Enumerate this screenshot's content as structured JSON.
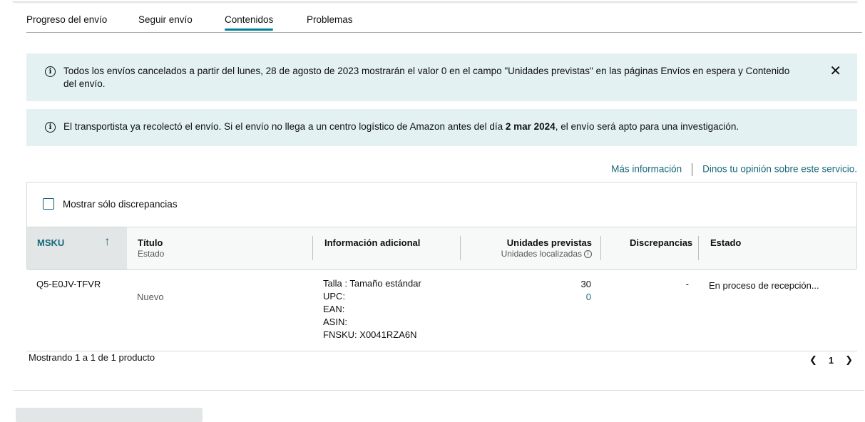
{
  "tabs": [
    {
      "label": "Progreso del envío"
    },
    {
      "label": "Seguir envío"
    },
    {
      "label": "Contenidos"
    },
    {
      "label": "Problemas"
    }
  ],
  "alerts": {
    "cancelled": {
      "line1": "Todos los envíos cancelados a partir del lunes, 28 de agosto de 2023 mostrarán el valor 0 en el campo \"Unidades previstas\" en las páginas Envíos en espera y Contenido",
      "line2": "del envío."
    },
    "carrier": {
      "before": "El transportista ya recolectó el envío. Si el envío no llega a un centro logístico de Amazon antes del día ",
      "date": "2 mar 2024",
      "after": ", el envío será apto para una investigación."
    }
  },
  "links": {
    "more_info": "Más información",
    "feedback": "Dinos tu opinión sobre este servicio."
  },
  "filter": {
    "show_discrepancies_label": "Mostrar sólo discrepancias"
  },
  "table": {
    "headers": {
      "msku": "MSKU",
      "title": "Título",
      "title_sub": "Estado",
      "info": "Información adicional",
      "expected": "Unidades previstas",
      "expected_sub": "Unidades localizadas",
      "discrepancies": "Discrepancias",
      "status": "Estado"
    },
    "rows": [
      {
        "msku": "Q5-E0JV-TFVR",
        "condition": "Nuevo",
        "info": {
          "size": "Talla : Tamaño estándar",
          "upc": "UPC:",
          "ean": "EAN:",
          "asin": "ASIN:",
          "fnsku": "FNSKU: X0041RZA6N"
        },
        "expected_units": "30",
        "located_units": "0",
        "discrepancies": "-",
        "status": "En proceso de recepción..."
      }
    ]
  },
  "footer": {
    "showing": "Mostrando 1 a 1 de 1 producto",
    "page": "1"
  },
  "colors": {
    "accent": "#008296",
    "link": "#16697a",
    "alert_bg": "#e3f1f2"
  }
}
